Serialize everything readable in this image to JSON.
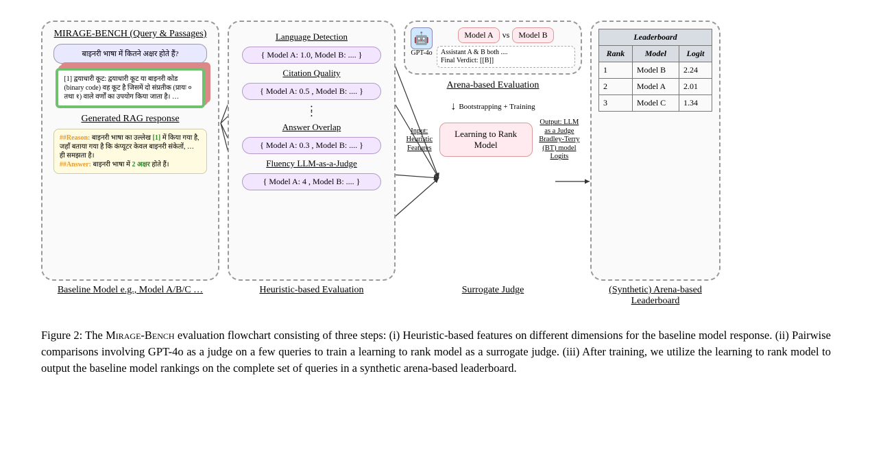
{
  "panel1": {
    "title": "MIRAGE-BENCH (Query & Passages)",
    "query_text": "बाइनरी भाषा में कितने अक्षर होते हैं?",
    "passage_text": "[1] द्वयाधारी कूट: द्वयाधारी कूट या बाइनरी कोड (binary code) वह कूट है जिसमें दो संप्रतीक (प्रायः ० तथा १) वाले वर्णों का उपयोग किया जाता है। …",
    "response_title": "Generated RAG response",
    "reason_label": "##Reason:",
    "reason_text": " बाइनरी भाषा का उल्लेख ",
    "citation_ref": "[1]",
    "reason_text2": " में किया गया है, जहाँ बताया गया है कि कंप्यूटर केवल बाइनरी संकेतों, … ही समझता है।",
    "answer_label": "##Answer:",
    "answer_text": " बाइनरी भाषा में ",
    "answer_highlight": "2 अक्षर",
    "answer_text2": " होते हैं।"
  },
  "panel2": {
    "metric1_title": "Language Detection",
    "metric1_value": "{ Model A:  1.0, Model B: .... }",
    "metric2_title": "Citation Quality",
    "metric2_value": "{ Model A:  0.5 , Model B: .... }",
    "metric3_title": "Answer Overlap",
    "metric3_value": "{ Model A:  0.3 , Model B: .... }",
    "metric4_title": "Fluency LLM-as-a-Judge",
    "metric4_value": "{ Model A:  4 , Model B: .... }"
  },
  "arena": {
    "model_a": "Model A",
    "vs": "vs",
    "model_b": "Model B",
    "assistant_line": "Assistant A & B both ....",
    "verdict_line": "Final Verdict: [[B]]",
    "gpt_label": "GPT-4o",
    "section_title": "Arena-based Evaluation",
    "bootstrap": "Bootstrapping + Training",
    "ltr": "Learning to Rank Model",
    "input_label": "Input: Heuristic Features",
    "output_label": "Output: LLM as a Judge Bradley-Terry (BT) model Logits"
  },
  "leaderboard": {
    "header": "Leaderboard",
    "cols": {
      "rank": "Rank",
      "model": "Model",
      "logit": "Logit"
    },
    "rows": [
      {
        "rank": "1",
        "model": "Model B",
        "logit": "2.24"
      },
      {
        "rank": "2",
        "model": "Model A",
        "logit": "2.01"
      },
      {
        "rank": "3",
        "model": "Model C",
        "logit": "1.34"
      }
    ]
  },
  "bottom_labels": {
    "l1": "Baseline Model e.g., Model A/B/C …",
    "l2": "Heuristic-based Evaluation",
    "l3": "Surrogate Judge",
    "l4": "(Synthetic) Arena-based Leaderboard"
  },
  "caption": {
    "prefix": "Figure 2: The ",
    "name": "Mirage-Bench",
    "rest": " evaluation flowchart consisting of three steps: (i) Heuristic-based features on different dimensions for the baseline model response. (ii) Pairwise comparisons involving GPT-4o as a judge on a few queries to train a learning to rank model as a surrogate judge. (iii) After training, we utilize the learning to rank model to output the baseline model rankings on the complete set of queries in a synthetic arena-based leaderboard."
  }
}
